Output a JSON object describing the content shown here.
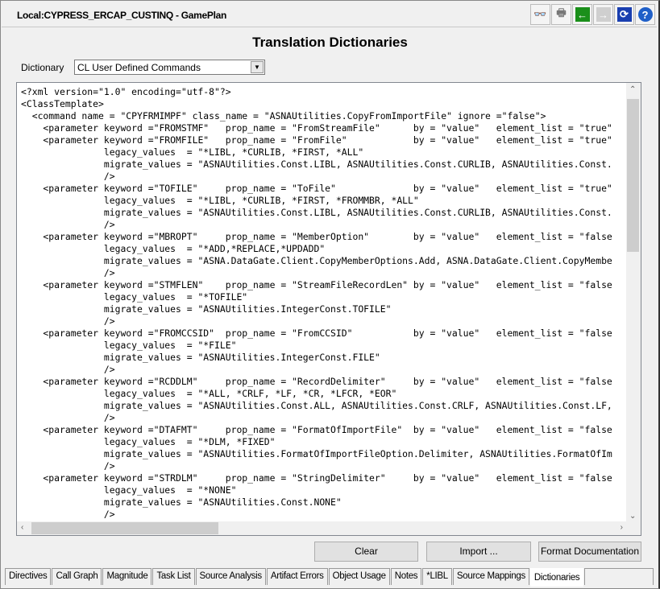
{
  "window": {
    "title": "Local:CYPRESS_ERCAP_CUSTINQ - GamePlan"
  },
  "toolbar": [
    {
      "icon": "binoculars-icon",
      "glyph": "👓",
      "color": "#555555"
    },
    {
      "icon": "printer-icon",
      "glyph": "🖶",
      "color": "#777777"
    },
    {
      "icon": "back-arrow-icon",
      "glyph": "←",
      "color": "#1a8f1a"
    },
    {
      "icon": "forward-arrow-icon",
      "glyph": "→",
      "color": "#b8b8b8"
    },
    {
      "icon": "refresh-icon",
      "glyph": "⟳",
      "color": "#1a3fb0"
    },
    {
      "icon": "help-icon",
      "glyph": "?",
      "color": "#1f5fc8"
    }
  ],
  "page": {
    "heading": "Translation Dictionaries"
  },
  "dictionary": {
    "label": "Dictionary",
    "selected": "CL User Defined Commands"
  },
  "editor": {
    "lines": [
      "<?xml version=\"1.0\" encoding=\"utf-8\"?>",
      "<ClassTemplate>",
      "  <command name = \"CPYFRMIMPF\" class_name = \"ASNAUtilities.CopyFromImportFile\" ignore =\"false\">",
      "    <parameter keyword =\"FROMSTMF\"   prop_name = \"FromStreamFile\"      by = \"value\"   element_list = \"true\"",
      "    <parameter keyword =\"FROMFILE\"   prop_name = \"FromFile\"            by = \"value\"   element_list = \"true\"",
      "               legacy_values  = \"*LIBL, *CURLIB, *FIRST, *ALL\"",
      "               migrate_values = \"ASNAUtilities.Const.LIBL, ASNAUtilities.Const.CURLIB, ASNAUtilities.Const.",
      "               />",
      "    <parameter keyword =\"TOFILE\"     prop_name = \"ToFile\"              by = \"value\"   element_list = \"true\"",
      "               legacy_values  = \"*LIBL, *CURLIB, *FIRST, *FROMMBR, *ALL\"",
      "               migrate_values = \"ASNAUtilities.Const.LIBL, ASNAUtilities.Const.CURLIB, ASNAUtilities.Const.",
      "               />",
      "    <parameter keyword =\"MBROPT\"     prop_name = \"MemberOption\"        by = \"value\"   element_list = \"false",
      "               legacy_values  = \"*ADD,*REPLACE,*UPDADD\"",
      "               migrate_values = \"ASNA.DataGate.Client.CopyMemberOptions.Add, ASNA.DataGate.Client.CopyMembe",
      "               />",
      "    <parameter keyword =\"STMFLEN\"    prop_name = \"StreamFileRecordLen\" by = \"value\"   element_list = \"false",
      "               legacy_values  = \"*TOFILE\"",
      "               migrate_values = \"ASNAUtilities.IntegerConst.TOFILE\"",
      "               />",
      "    <parameter keyword =\"FROMCCSID\"  prop_name = \"FromCCSID\"           by = \"value\"   element_list = \"false",
      "               legacy_values  = \"*FILE\"",
      "               migrate_values = \"ASNAUtilities.IntegerConst.FILE\"",
      "               />",
      "    <parameter keyword =\"RCDDLM\"     prop_name = \"RecordDelimiter\"     by = \"value\"   element_list = \"false",
      "               legacy_values  = \"*ALL, *CRLF, *LF, *CR, *LFCR, *EOR\"",
      "               migrate_values = \"ASNAUtilities.Const.ALL, ASNAUtilities.Const.CRLF, ASNAUtilities.Const.LF,",
      "               />",
      "    <parameter keyword =\"DTAFMT\"     prop_name = \"FormatOfImportFile\"  by = \"value\"   element_list = \"false",
      "               legacy_values  = \"*DLM, *FIXED\"",
      "               migrate_values = \"ASNAUtilities.FormatOfImportFileOption.Delimiter, ASNAUtilities.FormatOfIm",
      "               />",
      "    <parameter keyword =\"STRDLM\"     prop_name = \"StringDelimiter\"     by = \"value\"   element_list = \"false",
      "               legacy_values  = \"*NONE\"",
      "               migrate_values = \"ASNAUtilities.Const.NONE\"",
      "               />"
    ]
  },
  "buttons": {
    "clear": "Clear",
    "import": "Import ...",
    "format": "Format Documentation"
  },
  "tabs": [
    "Directives",
    "Call Graph",
    "Magnitude",
    "Task List",
    "Source Analysis",
    "Artifact Errors",
    "Object Usage",
    "Notes",
    "*LIBL",
    "Source Mappings",
    "Dictionaries"
  ],
  "active_tab": "Dictionaries"
}
